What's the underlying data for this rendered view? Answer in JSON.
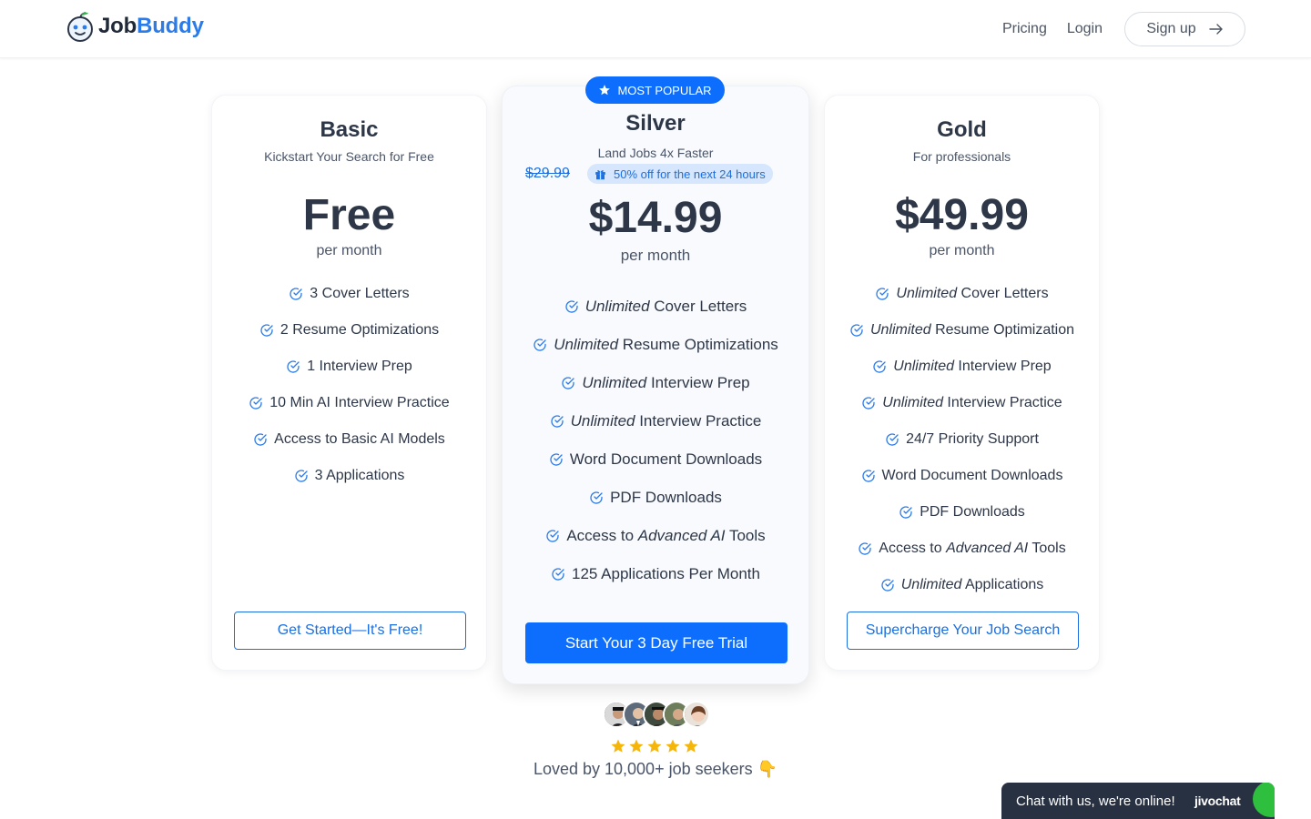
{
  "brand": {
    "name_part1": "Job",
    "name_part2": "Buddy",
    "accent": "#2b7be9"
  },
  "nav": {
    "pricing": "Pricing",
    "login": "Login",
    "signup": "Sign up"
  },
  "plans": {
    "basic": {
      "name": "Basic",
      "subtitle": "Kickstart Your Search for Free",
      "price": "Free",
      "period": "per month",
      "features": [
        {
          "em": "",
          "text": "3 Cover Letters"
        },
        {
          "em": "",
          "text": "2 Resume Optimizations"
        },
        {
          "em": "",
          "text": "1 Interview Prep"
        },
        {
          "em": "",
          "text": "10 Min AI Interview Practice"
        },
        {
          "em": "",
          "text": "Access to Basic AI Models"
        },
        {
          "em": "",
          "text": "3 Applications"
        }
      ],
      "cta": "Get Started—It's Free!"
    },
    "silver": {
      "badge": "MOST POPULAR",
      "name": "Silver",
      "subtitle": "Land Jobs 4x Faster",
      "old_price": "$29.99",
      "discount": "50% off for the next 24 hours",
      "price": "$14.99",
      "period": "per month",
      "features": [
        {
          "em": "Unlimited",
          "text": " Cover Letters"
        },
        {
          "em": "Unlimited",
          "text": " Resume Optimizations"
        },
        {
          "em": "Unlimited",
          "text": " Interview Prep"
        },
        {
          "em": "Unlimited",
          "text": " Interview Practice"
        },
        {
          "em": "",
          "text": "Word Document Downloads"
        },
        {
          "em": "",
          "text": "PDF Downloads"
        },
        {
          "pre": "Access to ",
          "em": "Advanced AI",
          "text": " Tools"
        },
        {
          "em": "",
          "text": "125 Applications Per Month"
        }
      ],
      "cta": "Start Your 3 Day Free Trial"
    },
    "gold": {
      "name": "Gold",
      "subtitle": "For professionals",
      "price": "$49.99",
      "period": "per month",
      "features": [
        {
          "em": "Unlimited",
          "text": " Cover Letters"
        },
        {
          "em": "Unlimited",
          "text": " Resume Optimization"
        },
        {
          "em": "Unlimited",
          "text": " Interview Prep"
        },
        {
          "em": "Unlimited",
          "text": " Interview Practice"
        },
        {
          "em": "",
          "text": "24/7 Priority Support"
        },
        {
          "em": "",
          "text": "Word Document Downloads"
        },
        {
          "em": "",
          "text": "PDF Downloads"
        },
        {
          "pre": "Access to ",
          "em": "Advanced AI",
          "text": " Tools"
        },
        {
          "em": "Unlimited",
          "text": " Applications"
        }
      ],
      "cta": "Supercharge Your Job Search"
    }
  },
  "social_proof": {
    "rating_stars": 5,
    "text": "Loved by 10,000+ job seekers 👇"
  },
  "chat": {
    "text": "Chat with us, we're online!",
    "brand": "jivochat"
  },
  "colors": {
    "primary": "#0d6efd",
    "text": "#2d3748",
    "star": "#f5b50a",
    "chat_bg": "#283142",
    "chat_green": "#2fbf3f"
  },
  "icons": [
    "logo-robot-icon",
    "arrow-right-icon",
    "check-circle-icon",
    "star-icon",
    "gift-icon"
  ]
}
